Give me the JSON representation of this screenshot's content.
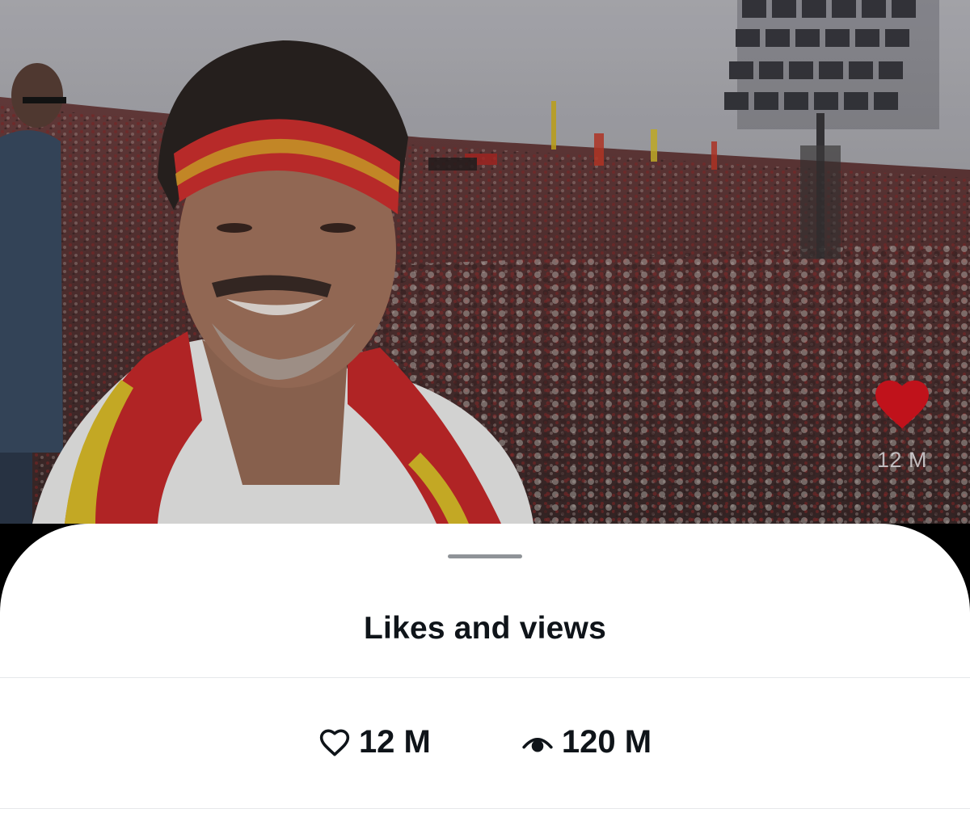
{
  "video": {
    "like_icon": "heart-filled-icon",
    "like_count": "12 M",
    "heart_color": "#c0121b"
  },
  "sheet": {
    "title": "Likes and views",
    "stats": {
      "likes": {
        "icon": "heart-outline-icon",
        "value": "12 M"
      },
      "views": {
        "icon": "eye-icon",
        "value": "120 M"
      }
    }
  }
}
